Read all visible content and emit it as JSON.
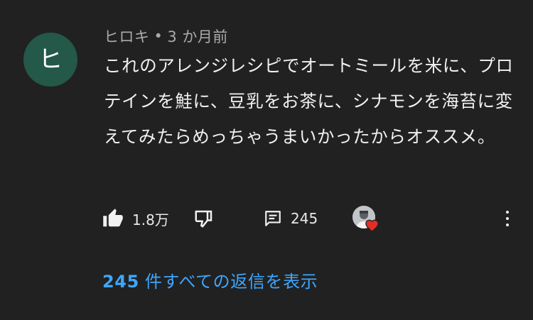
{
  "author": {
    "avatar_letter": "ヒ",
    "avatar_color": "#245849",
    "name": "ヒロキ",
    "separator": "•",
    "time": "3 か月前"
  },
  "comment": {
    "text": "これのアレンジレシピでオートミールを米に、プロテインを鮭に、豆乳をお茶に、シナモンを海苔に変えてみたらめっちゃうまいかったからオススメ。"
  },
  "actions": {
    "like_icon": "thumbs-up-icon",
    "like_count": "1.8万",
    "dislike_icon": "thumbs-down-icon",
    "reply_icon": "comment-icon",
    "reply_count": "245",
    "creator_heart": "creator-heart-icon",
    "more_icon": "more-vert-icon"
  },
  "replies": {
    "count": "245",
    "label": "件すべての返信を表示"
  },
  "colors": {
    "background": "#212121",
    "link": "#3ea6ff",
    "heart": "#e52d27"
  }
}
